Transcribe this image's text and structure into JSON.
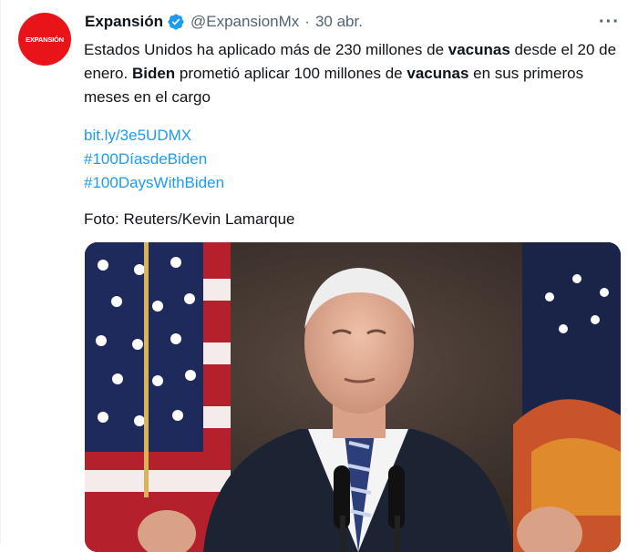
{
  "tweet": {
    "avatar_text": "EXPANSIÓN",
    "name": "Expansión",
    "handle": "@ExpansionMx",
    "separator": "·",
    "time": "30 abr.",
    "more": "···",
    "text": {
      "p1": "Estados Unidos ha aplicado más de 230 millones de ",
      "b1": "vacunas",
      "p2": " desde el 20 de enero. ",
      "b2": "Biden",
      "p3": " prometió aplicar 100 millones de ",
      "b3": "vacunas",
      "p4": " en sus primeros meses en el cargo"
    },
    "links": [
      "bit.ly/3e5UDMX",
      "#100DíasdeBiden",
      "#100DaysWithBiden"
    ],
    "credit": "Foto: Reuters/Kevin Lamarque"
  },
  "colors": {
    "accent": "#1d9bf0",
    "brand": "#e8141a",
    "muted": "#536471"
  }
}
